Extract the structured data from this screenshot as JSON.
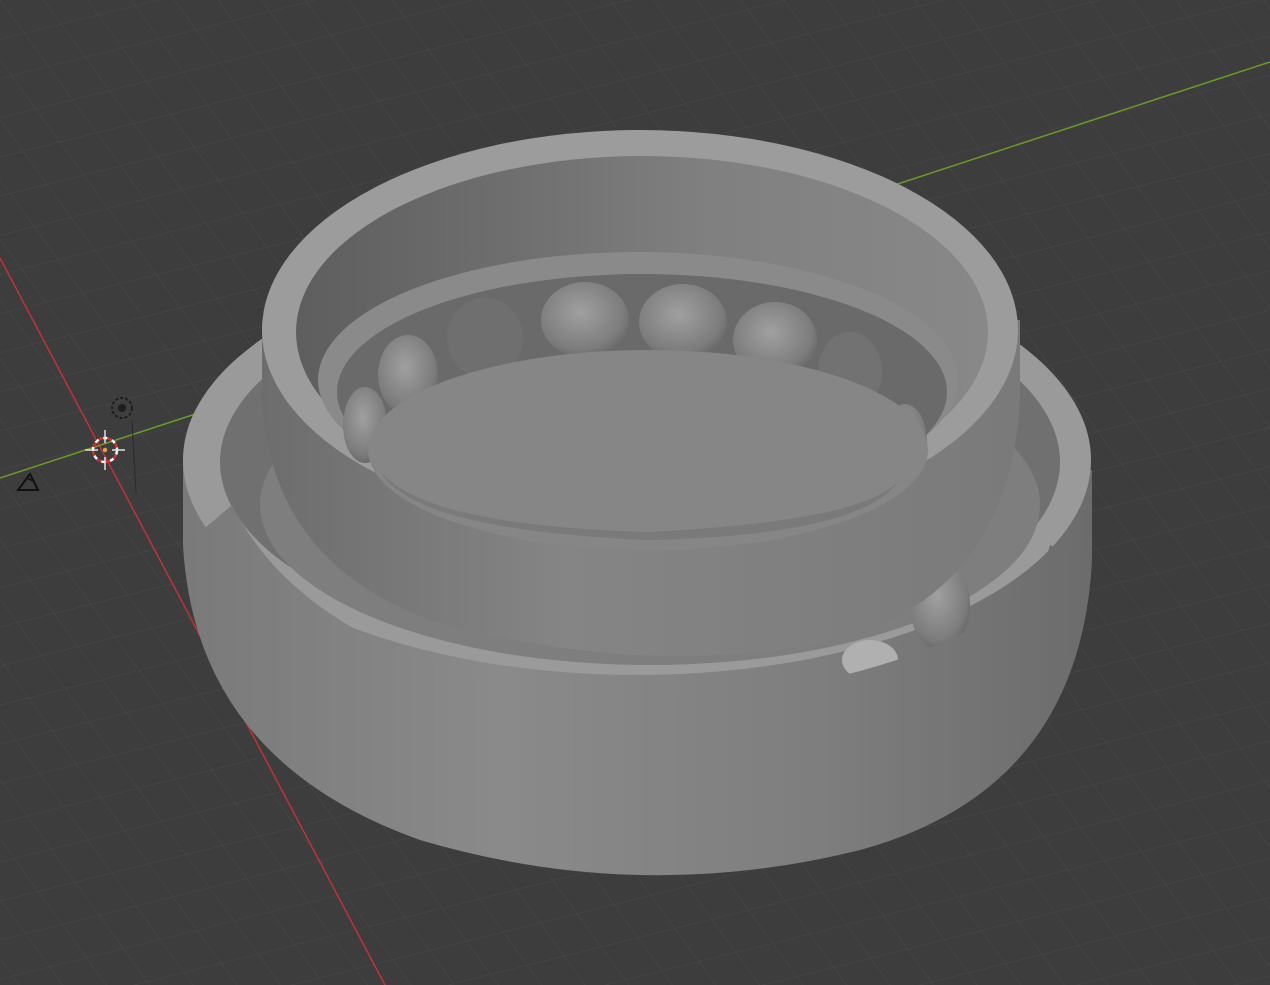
{
  "app": "3D viewport",
  "viewport": {
    "background_color": "#3d3d3d",
    "grid_line_color": "#4a4a4a",
    "x_axis_color": "#c0323a",
    "y_axis_color": "#6b9a2b",
    "icons": [
      "3d-cursor-icon",
      "light-object-icon",
      "camera-object-icon"
    ]
  },
  "model": {
    "name": "bearing",
    "shading": "solid",
    "surface_color": "#8e8e8e"
  }
}
